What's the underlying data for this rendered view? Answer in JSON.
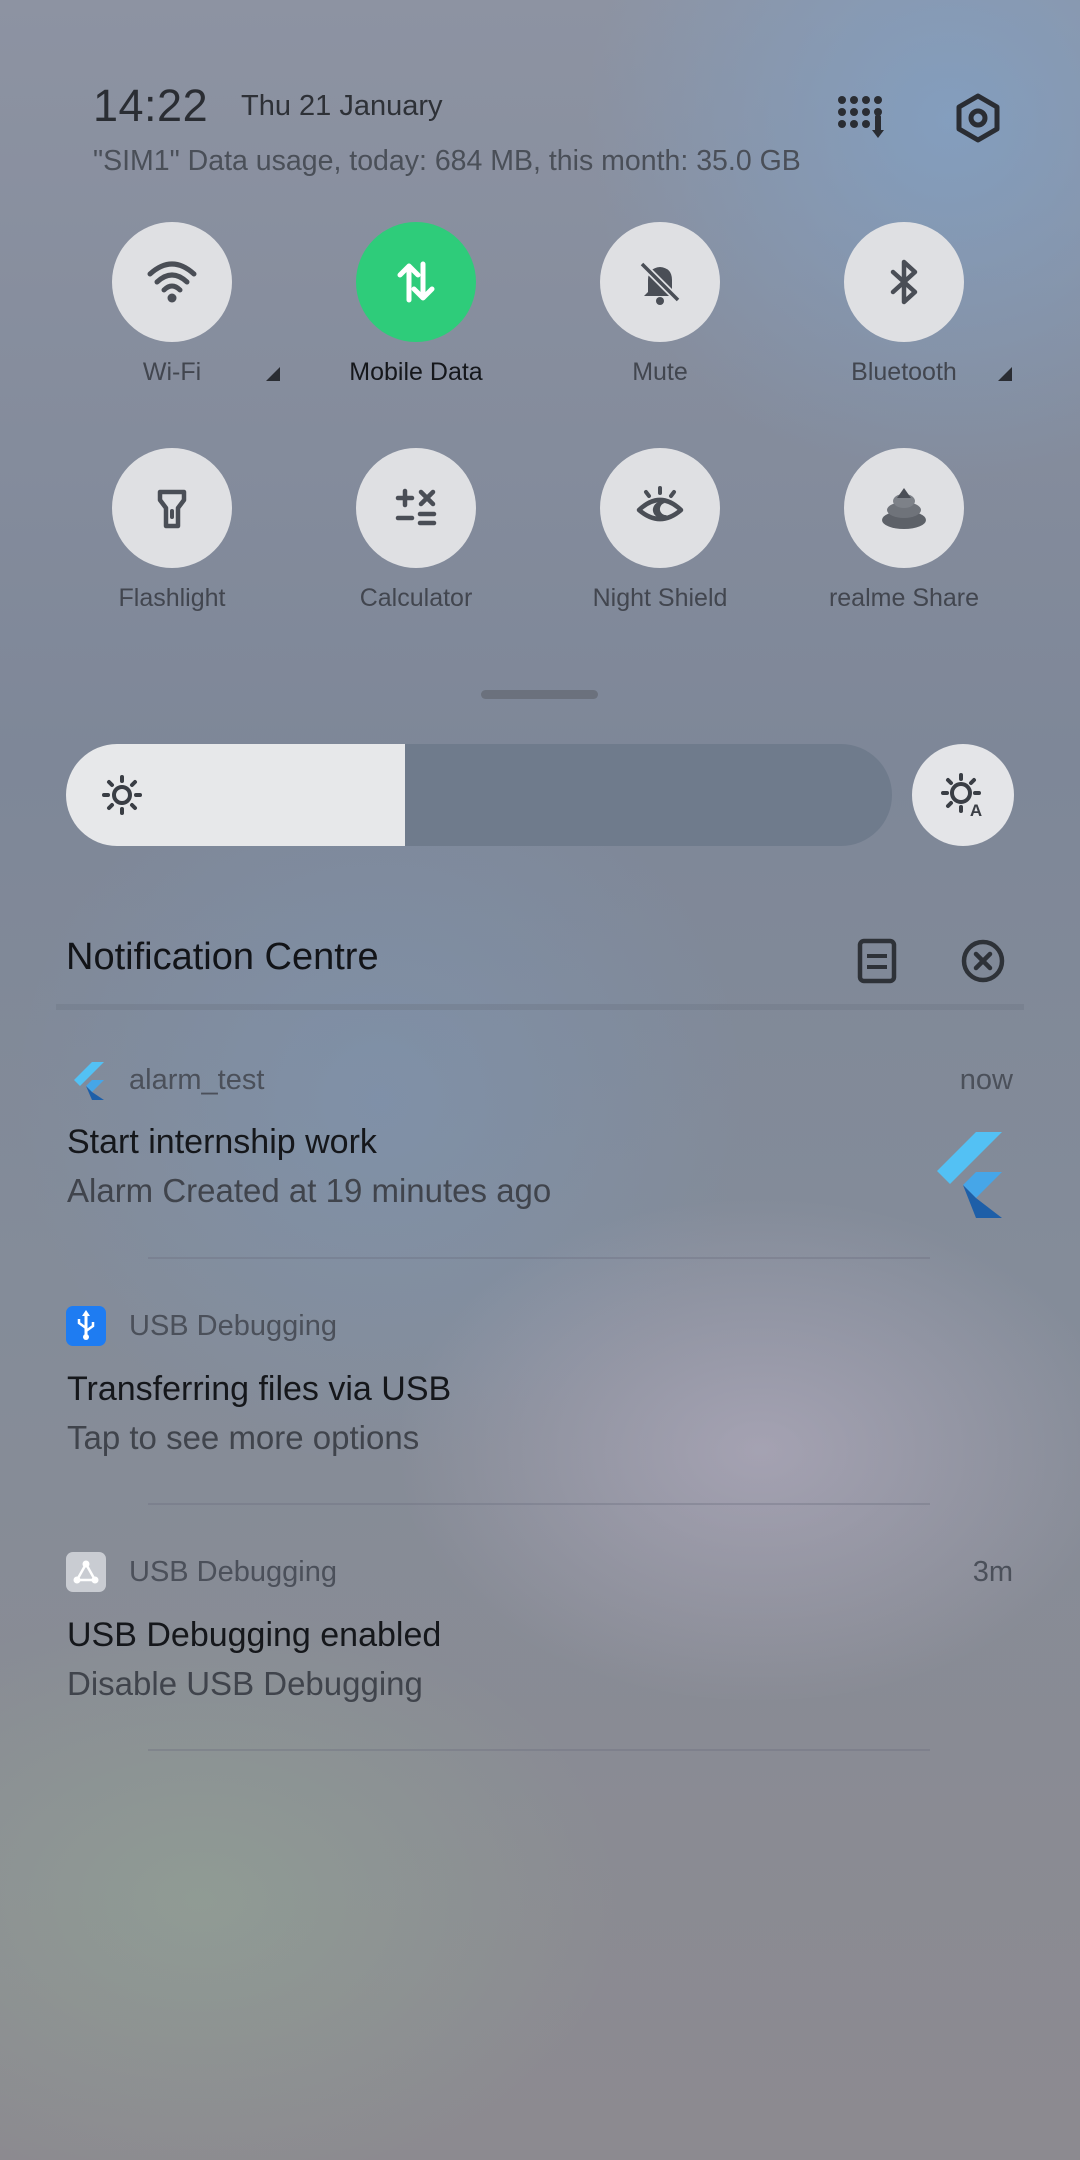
{
  "header": {
    "time": "14:22",
    "date": "Thu 21 January",
    "data_usage": "\"SIM1\" Data usage, today: 684 MB, this month: 35.0 GB",
    "icons": [
      "dialpad-grid-icon",
      "settings-hexagon-icon"
    ]
  },
  "tiles": [
    {
      "label": "Wi-Fi",
      "icon": "wifi-icon",
      "active": false,
      "has_more": true
    },
    {
      "label": "Mobile Data",
      "icon": "mobile-data-arrows-icon",
      "active": true,
      "has_more": false
    },
    {
      "label": "Mute",
      "icon": "bell-off-icon",
      "active": false,
      "has_more": false
    },
    {
      "label": "Bluetooth",
      "icon": "bluetooth-icon",
      "active": false,
      "has_more": true
    },
    {
      "label": "Flashlight",
      "icon": "flashlight-icon",
      "active": false,
      "has_more": false
    },
    {
      "label": "Calculator",
      "icon": "calculator-icon",
      "active": false,
      "has_more": false
    },
    {
      "label": "Night Shield",
      "icon": "eye-moon-icon",
      "active": false,
      "has_more": false
    },
    {
      "label": "realme Share",
      "icon": "realme-share-icon",
      "active": false,
      "has_more": false
    }
  ],
  "brightness": {
    "level": 0.41,
    "icon": "sun-icon",
    "auto_icon": "auto-brightness-icon"
  },
  "notification_centre": {
    "title": "Notification Centre",
    "icons": [
      "manage-notifications-icon",
      "clear-all-icon"
    ]
  },
  "notifications": [
    {
      "app": "alarm_test",
      "time": "now",
      "title": "Start internship work",
      "body": "Alarm Created at 19 minutes ago",
      "icon": "flutter-icon",
      "accent": "#3fa7ea"
    },
    {
      "app": "USB Debugging",
      "time": "",
      "title": "Transferring files via USB",
      "body": "Tap to see more options",
      "icon": "usb-icon",
      "accent": "#1e7cf2"
    },
    {
      "app": "USB Debugging",
      "time": "3m",
      "title": "USB Debugging enabled",
      "body": "Disable USB Debugging",
      "icon": "debug-nodes-icon",
      "accent": "#c9ccd2"
    }
  ],
  "colors": {
    "active_tile": "#2ecc7a",
    "tile_bg": "#dfe0e3",
    "slider_fill": "#e7e8ea"
  }
}
